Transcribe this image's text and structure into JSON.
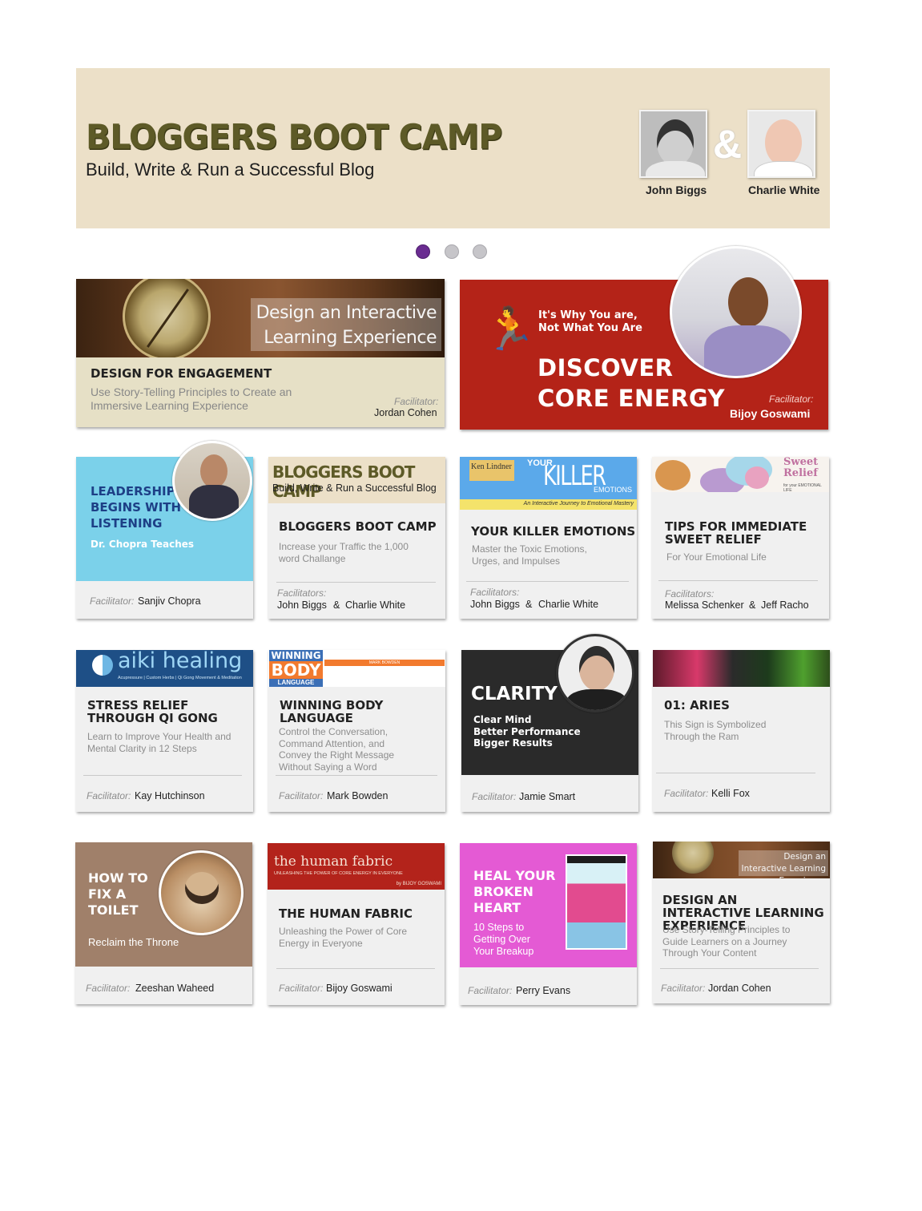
{
  "hero": {
    "title": "BLOGGERS BOOT CAMP",
    "subtitle": "Build, Write & Run a Successful Blog",
    "amp": "&",
    "presenters": [
      "John Biggs",
      "Charlie White"
    ]
  },
  "carousel": {
    "slides": 3,
    "active": 1
  },
  "labels": {
    "facilitator": "Facilitator:",
    "facilitators": "Facilitators:",
    "and": "&"
  },
  "featured": [
    {
      "image_text": "Design an Interactive Learning Experience",
      "title": "DESIGN FOR ENGAGEMENT",
      "subtitle": "Use Story-Telling Principles to Create an Immersive Learning Experience",
      "facilitator": "Jordan Cohen"
    },
    {
      "kicker_1": "It's Why You are,",
      "kicker_2": "Not What You Are",
      "headline_1": "DISCOVER",
      "headline_2": "CORE ENERGY",
      "facilitator": "Bijoy Goswami",
      "background": "#b42318"
    }
  ],
  "cards": {
    "lead": {
      "title_1": "LEADERSHIP",
      "title_2": "BEGINS WITH",
      "title_3": "LISTENING",
      "tag": "Dr. Chopra Teaches",
      "facilitator": "Sanjiv Chopra"
    },
    "blog": {
      "image_title": "BLOGGERS BOOT CAMP",
      "image_sub": "Build, Write & Run a Successful Blog",
      "title": "BLOGGERS BOOT CAMP",
      "subtitle": "Increase your Traffic the 1,000 word Challange",
      "facilitator_1": "John Biggs",
      "facilitator_2": "Charlie White"
    },
    "killer": {
      "image_author": "Ken Lindner",
      "image_your": "YOUR",
      "image_killer": "KILLER",
      "image_emotions": "EMOTIONS",
      "image_tagline": "An Interactive Journey to Emotional Mastery",
      "title": "YOUR KILLER EMOTIONS",
      "subtitle": "Master the Toxic Emotions, Urges, and Impulses",
      "facilitator_1": "John Biggs",
      "facilitator_2": "Charlie White"
    },
    "tips": {
      "image_title_1": "Sweet",
      "image_title_2": "Relief",
      "image_tag": "for your EMOTIONAL LIFE",
      "title": "TIPS FOR IMMEDIATE SWEET RELIEF",
      "subtitle": "For Your Emotional Life",
      "facilitator_1": "Melissa Schenker",
      "facilitator_2": "Jeff Racho"
    },
    "aiki": {
      "image_title": "aiki healing",
      "image_sub": "Acupressure | Custom Herbs | Qi Gong Movement & Meditation",
      "title": "STRESS RELIEF THROUGH QI GONG",
      "subtitle": "Learn to Improve Your Health and Mental Clarity in 12 Steps",
      "facilitator": "Kay Hutchinson"
    },
    "body": {
      "image_w1": "WINNING",
      "image_w2": "BODY",
      "image_w3": "LANGUAGE",
      "image_author": "MARK BOWDEN",
      "title": "WINNING BODY LANGUAGE",
      "subtitle": "Control the Conversation, Command Attention, and Convey the Right Message Without Saying a Word",
      "facilitator": "Mark Bowden"
    },
    "clarity": {
      "title": "CLARITY",
      "line_1": "Clear Mind",
      "line_2": "Better Performance",
      "line_3": "Bigger Results",
      "facilitator": "Jamie Smart"
    },
    "aries": {
      "title": "01: ARIES",
      "subtitle": "This Sign is Symbolized Through the Ram",
      "facilitator": "Kelli Fox"
    },
    "pug": {
      "title_1": "HOW TO",
      "title_2": "FIX A",
      "title_3": "TOILET",
      "tag": "Reclaim the Throne",
      "facilitator": "Zeeshan Waheed"
    },
    "fabric": {
      "image_title": "the human fabric",
      "image_sub": "UNLEASHING THE POWER OF CORE ENERGY IN EVERYONE",
      "image_author": "by BIJOY GOSWAMI",
      "title": "THE HUMAN FABRIC",
      "subtitle": "Unleashing the Power of Core Energy in Everyone",
      "facilitator": "Bijoy Goswami"
    },
    "heal": {
      "title_1": "HEAL YOUR",
      "title_2": "BROKEN",
      "title_3": "HEART",
      "line_1": "10 Steps to",
      "line_2": "Getting Over",
      "line_3": "Your Breakup",
      "facilitator": "Perry Evans"
    },
    "design2": {
      "image_text": "Design an Interactive Learning Experience",
      "title": "DESIGN AN INTERACTIVE LEARNING EXPERIENCE",
      "subtitle": "Use Story-Telling Principles to Guide Learners on a Journey Through Your Content",
      "facilitator": "Jordan Cohen"
    }
  }
}
